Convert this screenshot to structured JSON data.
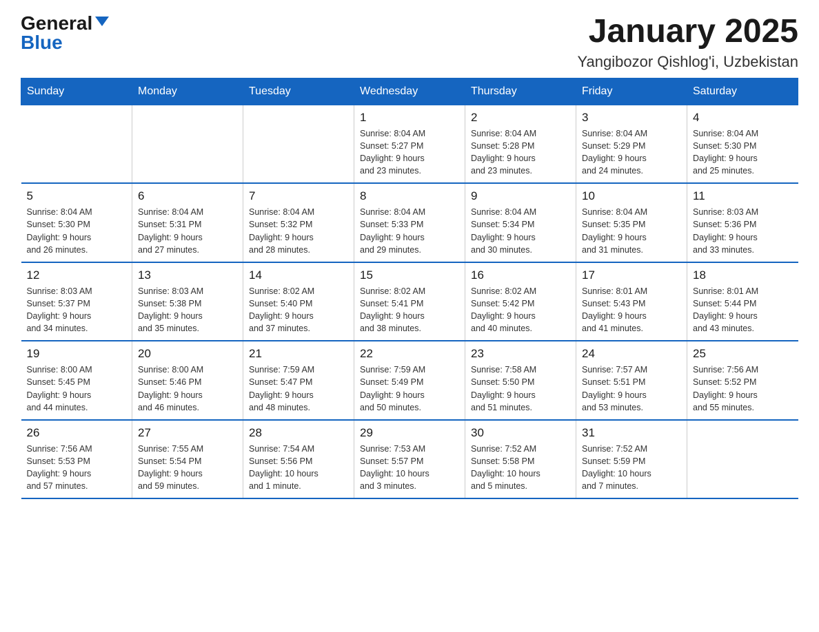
{
  "logo": {
    "general": "General",
    "blue": "Blue"
  },
  "title": "January 2025",
  "subtitle": "Yangibozor Qishlog'i, Uzbekistan",
  "header": {
    "days": [
      "Sunday",
      "Monday",
      "Tuesday",
      "Wednesday",
      "Thursday",
      "Friday",
      "Saturday"
    ]
  },
  "weeks": [
    [
      {
        "day": "",
        "info": ""
      },
      {
        "day": "",
        "info": ""
      },
      {
        "day": "",
        "info": ""
      },
      {
        "day": "1",
        "info": "Sunrise: 8:04 AM\nSunset: 5:27 PM\nDaylight: 9 hours\nand 23 minutes."
      },
      {
        "day": "2",
        "info": "Sunrise: 8:04 AM\nSunset: 5:28 PM\nDaylight: 9 hours\nand 23 minutes."
      },
      {
        "day": "3",
        "info": "Sunrise: 8:04 AM\nSunset: 5:29 PM\nDaylight: 9 hours\nand 24 minutes."
      },
      {
        "day": "4",
        "info": "Sunrise: 8:04 AM\nSunset: 5:30 PM\nDaylight: 9 hours\nand 25 minutes."
      }
    ],
    [
      {
        "day": "5",
        "info": "Sunrise: 8:04 AM\nSunset: 5:30 PM\nDaylight: 9 hours\nand 26 minutes."
      },
      {
        "day": "6",
        "info": "Sunrise: 8:04 AM\nSunset: 5:31 PM\nDaylight: 9 hours\nand 27 minutes."
      },
      {
        "day": "7",
        "info": "Sunrise: 8:04 AM\nSunset: 5:32 PM\nDaylight: 9 hours\nand 28 minutes."
      },
      {
        "day": "8",
        "info": "Sunrise: 8:04 AM\nSunset: 5:33 PM\nDaylight: 9 hours\nand 29 minutes."
      },
      {
        "day": "9",
        "info": "Sunrise: 8:04 AM\nSunset: 5:34 PM\nDaylight: 9 hours\nand 30 minutes."
      },
      {
        "day": "10",
        "info": "Sunrise: 8:04 AM\nSunset: 5:35 PM\nDaylight: 9 hours\nand 31 minutes."
      },
      {
        "day": "11",
        "info": "Sunrise: 8:03 AM\nSunset: 5:36 PM\nDaylight: 9 hours\nand 33 minutes."
      }
    ],
    [
      {
        "day": "12",
        "info": "Sunrise: 8:03 AM\nSunset: 5:37 PM\nDaylight: 9 hours\nand 34 minutes."
      },
      {
        "day": "13",
        "info": "Sunrise: 8:03 AM\nSunset: 5:38 PM\nDaylight: 9 hours\nand 35 minutes."
      },
      {
        "day": "14",
        "info": "Sunrise: 8:02 AM\nSunset: 5:40 PM\nDaylight: 9 hours\nand 37 minutes."
      },
      {
        "day": "15",
        "info": "Sunrise: 8:02 AM\nSunset: 5:41 PM\nDaylight: 9 hours\nand 38 minutes."
      },
      {
        "day": "16",
        "info": "Sunrise: 8:02 AM\nSunset: 5:42 PM\nDaylight: 9 hours\nand 40 minutes."
      },
      {
        "day": "17",
        "info": "Sunrise: 8:01 AM\nSunset: 5:43 PM\nDaylight: 9 hours\nand 41 minutes."
      },
      {
        "day": "18",
        "info": "Sunrise: 8:01 AM\nSunset: 5:44 PM\nDaylight: 9 hours\nand 43 minutes."
      }
    ],
    [
      {
        "day": "19",
        "info": "Sunrise: 8:00 AM\nSunset: 5:45 PM\nDaylight: 9 hours\nand 44 minutes."
      },
      {
        "day": "20",
        "info": "Sunrise: 8:00 AM\nSunset: 5:46 PM\nDaylight: 9 hours\nand 46 minutes."
      },
      {
        "day": "21",
        "info": "Sunrise: 7:59 AM\nSunset: 5:47 PM\nDaylight: 9 hours\nand 48 minutes."
      },
      {
        "day": "22",
        "info": "Sunrise: 7:59 AM\nSunset: 5:49 PM\nDaylight: 9 hours\nand 50 minutes."
      },
      {
        "day": "23",
        "info": "Sunrise: 7:58 AM\nSunset: 5:50 PM\nDaylight: 9 hours\nand 51 minutes."
      },
      {
        "day": "24",
        "info": "Sunrise: 7:57 AM\nSunset: 5:51 PM\nDaylight: 9 hours\nand 53 minutes."
      },
      {
        "day": "25",
        "info": "Sunrise: 7:56 AM\nSunset: 5:52 PM\nDaylight: 9 hours\nand 55 minutes."
      }
    ],
    [
      {
        "day": "26",
        "info": "Sunrise: 7:56 AM\nSunset: 5:53 PM\nDaylight: 9 hours\nand 57 minutes."
      },
      {
        "day": "27",
        "info": "Sunrise: 7:55 AM\nSunset: 5:54 PM\nDaylight: 9 hours\nand 59 minutes."
      },
      {
        "day": "28",
        "info": "Sunrise: 7:54 AM\nSunset: 5:56 PM\nDaylight: 10 hours\nand 1 minute."
      },
      {
        "day": "29",
        "info": "Sunrise: 7:53 AM\nSunset: 5:57 PM\nDaylight: 10 hours\nand 3 minutes."
      },
      {
        "day": "30",
        "info": "Sunrise: 7:52 AM\nSunset: 5:58 PM\nDaylight: 10 hours\nand 5 minutes."
      },
      {
        "day": "31",
        "info": "Sunrise: 7:52 AM\nSunset: 5:59 PM\nDaylight: 10 hours\nand 7 minutes."
      },
      {
        "day": "",
        "info": ""
      }
    ]
  ]
}
